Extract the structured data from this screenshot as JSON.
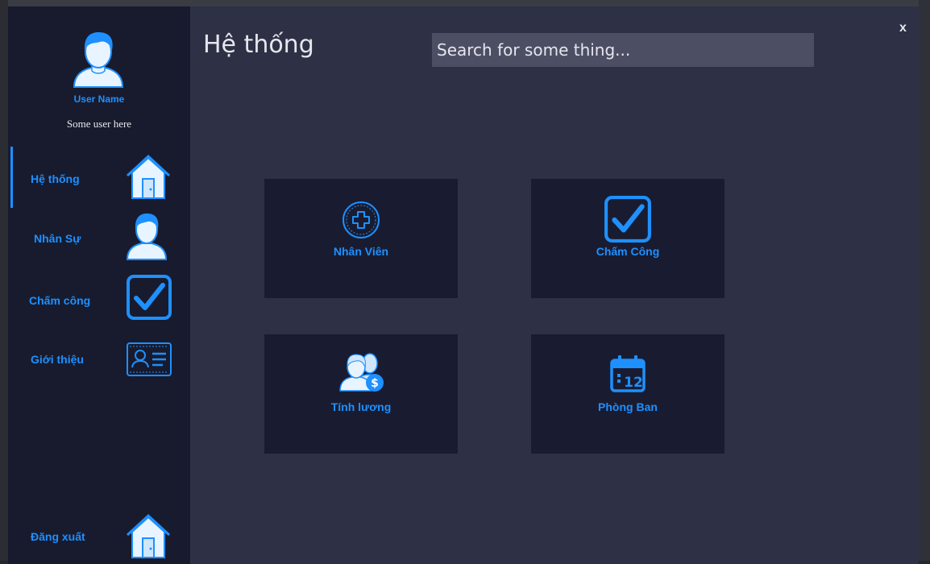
{
  "window": {
    "close_label": "x"
  },
  "header": {
    "title": "Hệ thống",
    "search_placeholder": "Search for some thing..."
  },
  "user": {
    "name": "User Name",
    "subtitle": "Some user here"
  },
  "sidebar": {
    "items": [
      {
        "label": "Hệ thống",
        "icon": "house-icon",
        "active": true
      },
      {
        "label": "Nhân Sự",
        "icon": "user-icon"
      },
      {
        "label": "Chấm công",
        "icon": "checkbox-icon"
      },
      {
        "label": "Giới thiệu",
        "icon": "id-card-icon"
      }
    ],
    "logout": {
      "label": "Đăng xuất",
      "icon": "house-icon"
    }
  },
  "tiles": [
    {
      "label": "Nhân Viên",
      "icon": "plus-circle-icon"
    },
    {
      "label": "Chấm Công",
      "icon": "checkbox-icon"
    },
    {
      "label": "Tính lương",
      "icon": "salary-icon"
    },
    {
      "label": "Phòng Ban",
      "icon": "calendar-icon"
    }
  ],
  "colors": {
    "accent": "#1e90ff",
    "sidebar_bg": "#181b2e",
    "main_bg": "#2e3145",
    "tile_bg": "#191c31",
    "search_bg": "#4c4f64"
  }
}
